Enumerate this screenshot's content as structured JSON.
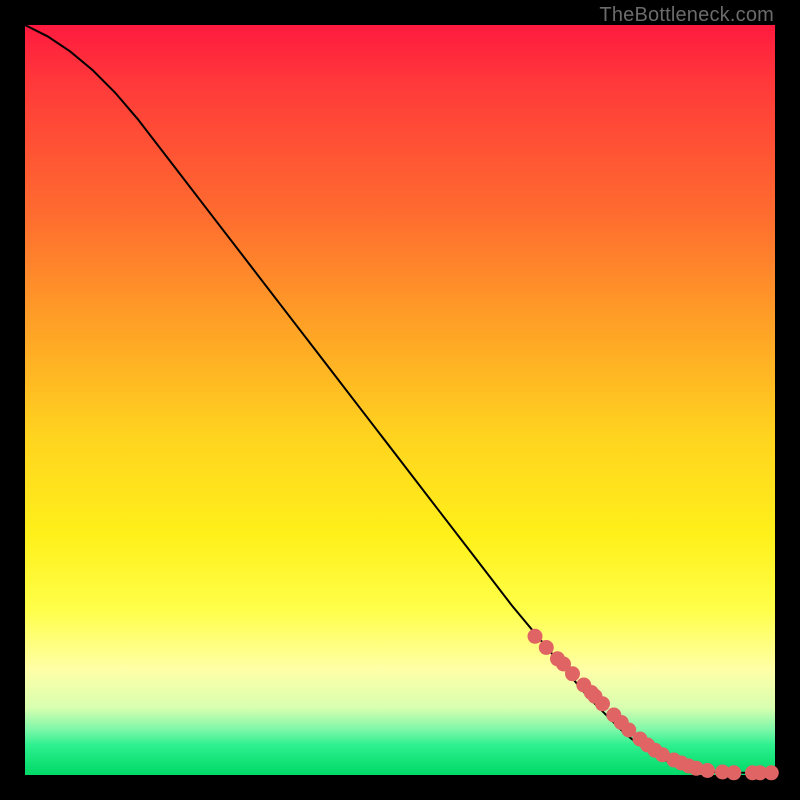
{
  "watermark": "TheBottleneck.com",
  "colors": {
    "dot": "#e06464",
    "line": "#000000",
    "frame": "#000000"
  },
  "chart_data": {
    "type": "line",
    "title": "",
    "xlabel": "",
    "ylabel": "",
    "xlim": [
      0,
      100
    ],
    "ylim": [
      0,
      100
    ],
    "grid": false,
    "legend": false,
    "series": [
      {
        "name": "curve",
        "kind": "line",
        "x": [
          0,
          3,
          6,
          9,
          12,
          15,
          20,
          25,
          30,
          35,
          40,
          45,
          50,
          55,
          60,
          65,
          70,
          75,
          80,
          83,
          85,
          87,
          88,
          90,
          92,
          94,
          96,
          98,
          100
        ],
        "y": [
          100,
          98.5,
          96.5,
          94,
          91,
          87.5,
          81,
          74.5,
          68,
          61.5,
          55,
          48.5,
          42,
          35.5,
          29,
          22.5,
          16.5,
          10.5,
          5.5,
          3.2,
          2.1,
          1.3,
          1.0,
          0.6,
          0.4,
          0.3,
          0.3,
          0.3,
          0.3
        ]
      },
      {
        "name": "highlighted-points",
        "kind": "scatter",
        "x": [
          68,
          69.5,
          71,
          71.8,
          73,
          74.5,
          75.5,
          76,
          77,
          78.5,
          79.5,
          80.5,
          82,
          83,
          84,
          85,
          86.5,
          87.5,
          88.5,
          89.5,
          91,
          93,
          94.5,
          97,
          98,
          99.5
        ],
        "y": [
          18.5,
          17,
          15.5,
          14.8,
          13.5,
          12,
          11,
          10.5,
          9.5,
          8,
          7,
          6,
          4.8,
          4,
          3.3,
          2.7,
          2,
          1.6,
          1.2,
          0.9,
          0.6,
          0.4,
          0.3,
          0.3,
          0.3,
          0.3
        ]
      }
    ]
  }
}
